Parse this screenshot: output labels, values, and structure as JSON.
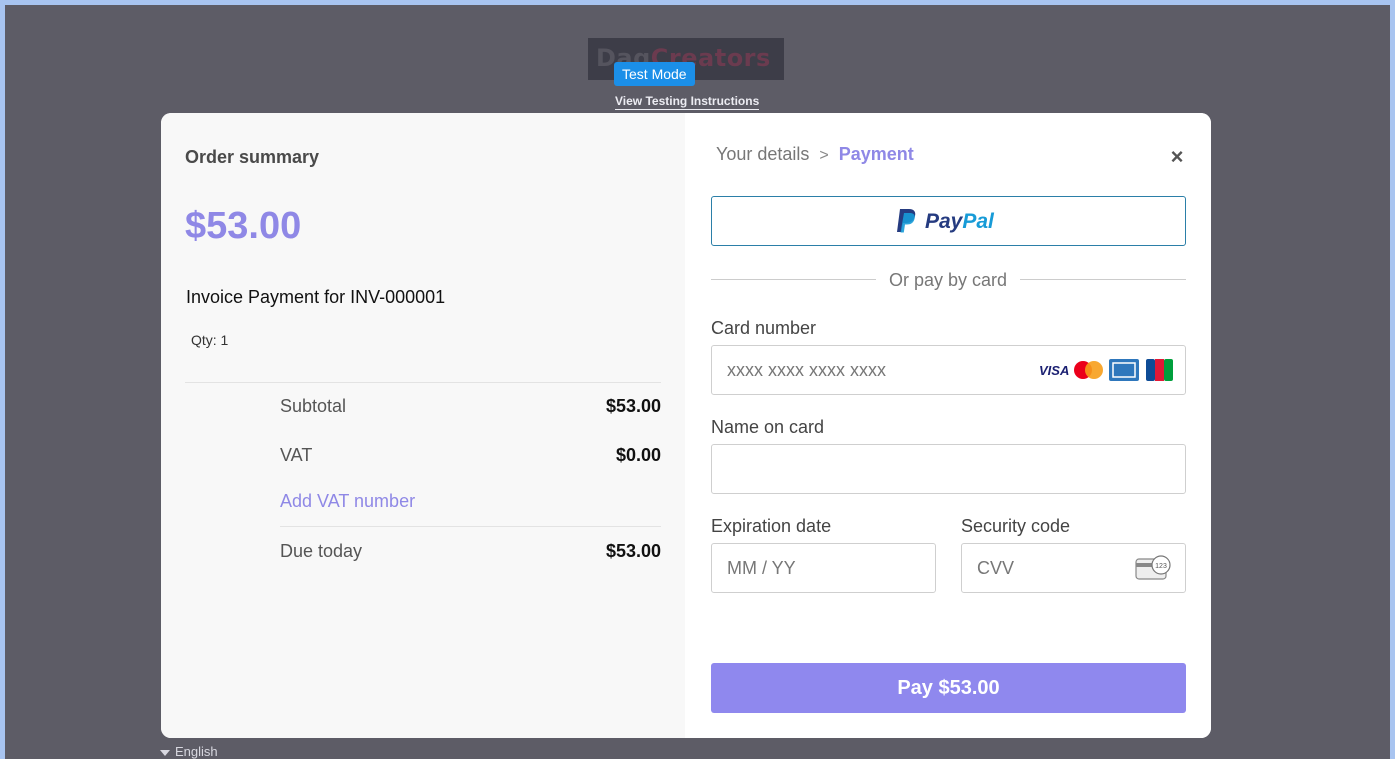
{
  "header": {
    "logo_text_dark": "Dag",
    "logo_text_accent": "Creators",
    "test_mode_badge": "Test Mode",
    "testing_link": "View Testing Instructions"
  },
  "footer": {
    "language": "English"
  },
  "summary": {
    "title": "Order summary",
    "amount": "$53.00",
    "item_name": "Invoice Payment for INV-000001",
    "qty": "Qty: 1",
    "rows": [
      {
        "label": "Subtotal",
        "value": "$53.00"
      },
      {
        "label": "VAT",
        "value": "$0.00"
      }
    ],
    "add_vat_label": "Add VAT number",
    "due": {
      "label": "Due today",
      "value": "$53.00"
    }
  },
  "payment": {
    "breadcrumb_step1": "Your details",
    "breadcrumb_sep": ">",
    "breadcrumb_step2": "Payment",
    "close_icon": "×",
    "paypal_pay": "Pay",
    "paypal_pal": "Pal",
    "or_text": "Or pay by card",
    "card_number_label": "Card number",
    "card_number_placeholder": "xxxx xxxx xxxx xxxx",
    "card_brands": [
      "visa",
      "mastercard",
      "amex",
      "jcb"
    ],
    "visa_text": "VISA",
    "name_label": "Name on card",
    "name_value": "",
    "expiry_label": "Expiration date",
    "expiry_placeholder": "MM / YY",
    "cvv_label": "Security code",
    "cvv_placeholder": "CVV",
    "cvv_icon_text": "123",
    "pay_button": "Pay $53.00"
  },
  "colors": {
    "accent": "#8f88e6",
    "pay_button": "#8f88ee",
    "badge": "#1b8fe8",
    "overlay": "#5d5c66"
  }
}
